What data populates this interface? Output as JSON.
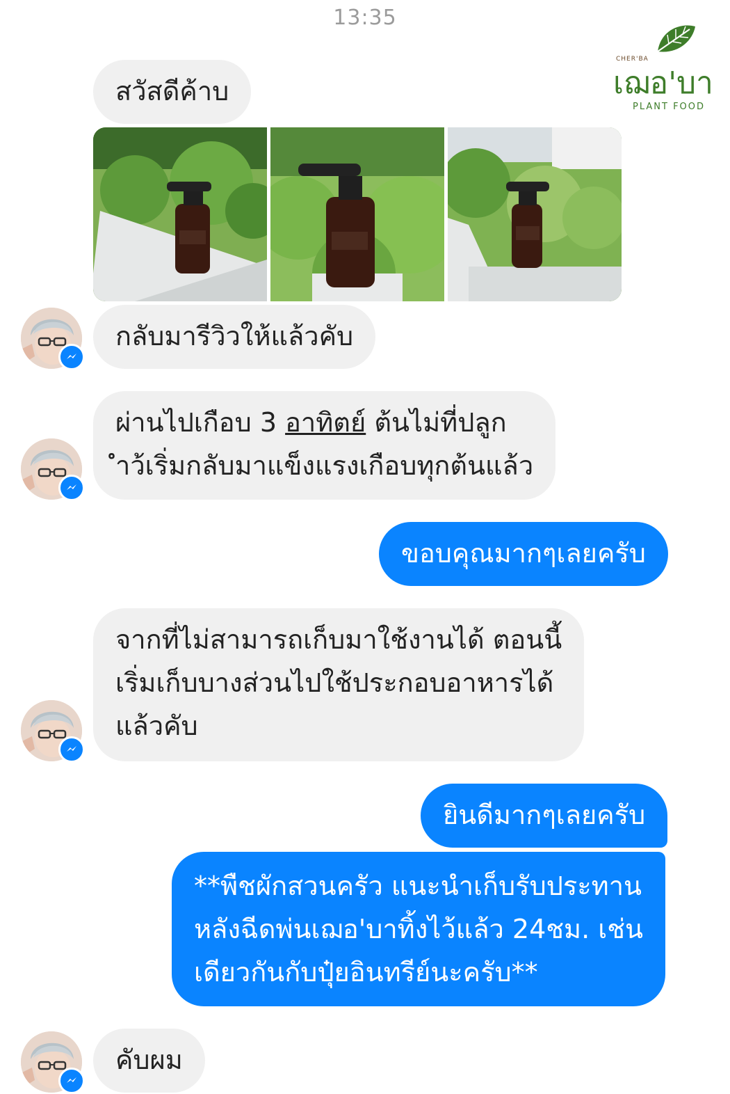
{
  "status": {
    "time": "13:35"
  },
  "brand": {
    "small": "CHER'BA",
    "name": "เฌอ'บา",
    "subtitle": "PLANT  FOOD"
  },
  "messages": {
    "m1": "สวัสดีค้าบ",
    "m2": "กลับมารีวิวให้แล้วคับ",
    "m3_line1_pre": "ผ่านไปเกือบ 3 ",
    "m3_line1_link": "อาทิตย์",
    "m3_line1_post": " ต้นไม่ที่ปลูก",
    "m3_line2": "ำว้เริ่มกลับมาแข็งแรงเกือบทุกต้นแล้ว",
    "m4": "ขอบคุณมากๆเลยครับ",
    "m5_line1": "จากที่ไม่สามารถเก็บมาใช้งานได้ ตอนนี้",
    "m5_line2": "เริ่มเก็บบางส่วนไปใช้ประกอบอาหารได้",
    "m5_line3": "แล้วคับ",
    "m6": "ยินดีมากๆเลยครับ",
    "m7_line1": "**พืชผักสวนครัว แนะนำเก็บรับประทาน",
    "m7_line2": "หลังฉีดพ่นเฌอ'บาทิ้งไว้แล้ว 24ชม. เช่น",
    "m7_line3": "เดียวกันกับปุ๋ยอินทรีย์นะครับ**",
    "m8": "คับผม"
  },
  "colors": {
    "outgoing": "#0a84ff",
    "incoming": "#f0f0f0",
    "timestamp": "#9b9b9b"
  }
}
